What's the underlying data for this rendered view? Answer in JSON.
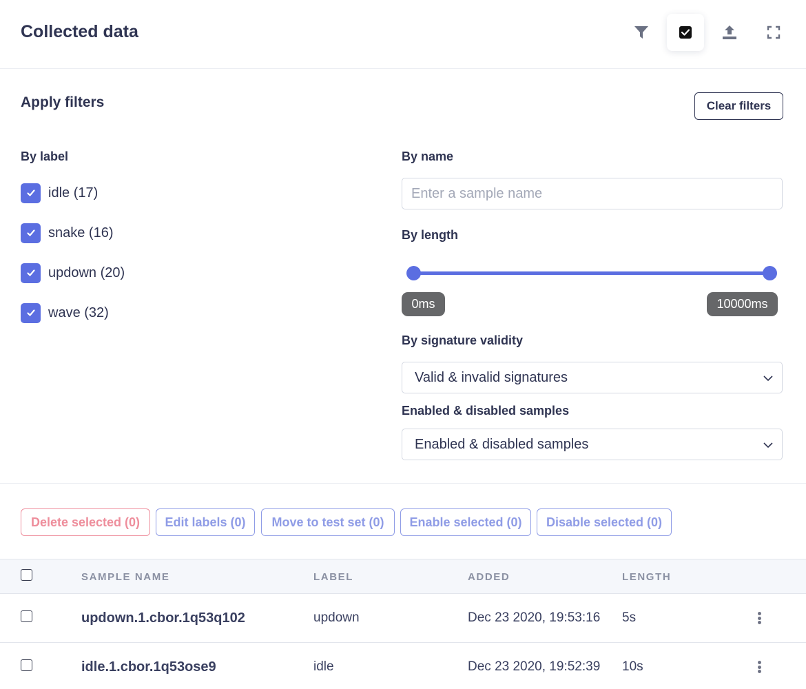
{
  "header": {
    "title": "Collected data",
    "icons": [
      "filter-icon",
      "checkbox-icon",
      "upload-icon",
      "fullscreen-icon"
    ]
  },
  "filters": {
    "title": "Apply filters",
    "clear_label": "Clear filters",
    "by_label": {
      "heading": "By label",
      "items": [
        {
          "text": "idle (17)",
          "checked": true
        },
        {
          "text": "snake (16)",
          "checked": true
        },
        {
          "text": "updown (20)",
          "checked": true
        },
        {
          "text": "wave (32)",
          "checked": true
        }
      ]
    },
    "by_name": {
      "heading": "By name",
      "value": "",
      "placeholder": "Enter a sample name"
    },
    "by_length": {
      "heading": "By length",
      "min_label": "0ms",
      "max_label": "10000ms"
    },
    "by_signature": {
      "heading": "By signature validity",
      "selected": "Valid & invalid signatures"
    },
    "by_enabled": {
      "heading": "Enabled & disabled samples",
      "selected": "Enabled & disabled samples"
    }
  },
  "actions": {
    "delete": "Delete selected (0)",
    "edit": "Edit labels (0)",
    "move": "Move to test set (0)",
    "enable": "Enable selected (0)",
    "disable": "Disable selected (0)"
  },
  "table": {
    "columns": [
      "SAMPLE NAME",
      "LABEL",
      "ADDED",
      "LENGTH"
    ],
    "rows": [
      {
        "name": "updown.1.cbor.1q53q102",
        "label": "updown",
        "added": "Dec 23 2020, 19:53:16",
        "length": "5s"
      },
      {
        "name": "idle.1.cbor.1q53ose9",
        "label": "idle",
        "added": "Dec 23 2020, 19:52:39",
        "length": "10s"
      }
    ]
  },
  "colors": {
    "accent": "#5b6ee1",
    "danger": "#ee8e9c",
    "button_muted": "#8f9ce6",
    "text": "#2f3452",
    "pill_bg": "#666769"
  }
}
